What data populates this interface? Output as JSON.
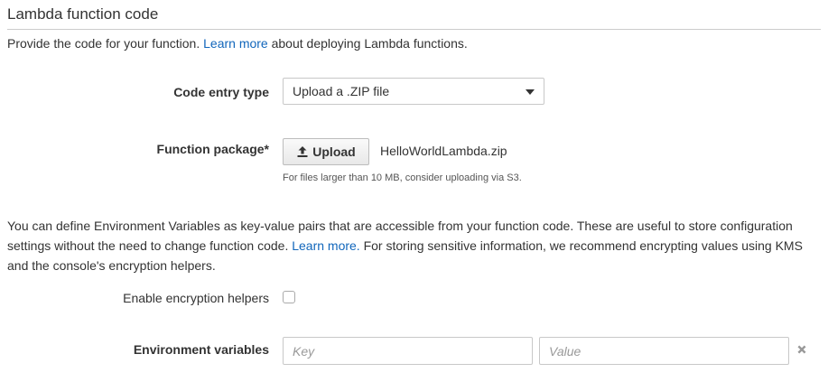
{
  "section": {
    "title": "Lambda function code",
    "intro_before_link": "Provide the code for your function. ",
    "intro_link": "Learn more",
    "intro_after_link": " about deploying Lambda functions."
  },
  "code_entry": {
    "label": "Code entry type",
    "selected_value": "Upload a .ZIP file",
    "icon": "chevron-down-icon"
  },
  "function_package": {
    "label": "Function package*",
    "upload_button_label": "Upload",
    "upload_icon": "upload-icon",
    "file_name": "HelloWorldLambda.zip",
    "help_text": "For files larger than 10 MB, consider uploading via S3."
  },
  "environment": {
    "description_before_link": "You can define Environment Variables as key-value pairs that are accessible from your function code. These are useful to store configuration settings without the need to change function code. ",
    "description_link": "Learn more.",
    "description_after_link": " For storing sensitive information, we recommend encrypting values using KMS and the console's encryption helpers.",
    "encryption_label": "Enable encryption helpers",
    "encryption_checked": false,
    "variables_label": "Environment variables",
    "key_placeholder": "Key",
    "key_value": "",
    "value_placeholder": "Value",
    "value_value": "",
    "remove_icon": "close-icon"
  },
  "colors": {
    "link": "#1166bb",
    "text": "#333333",
    "border": "#c8c8c8"
  }
}
